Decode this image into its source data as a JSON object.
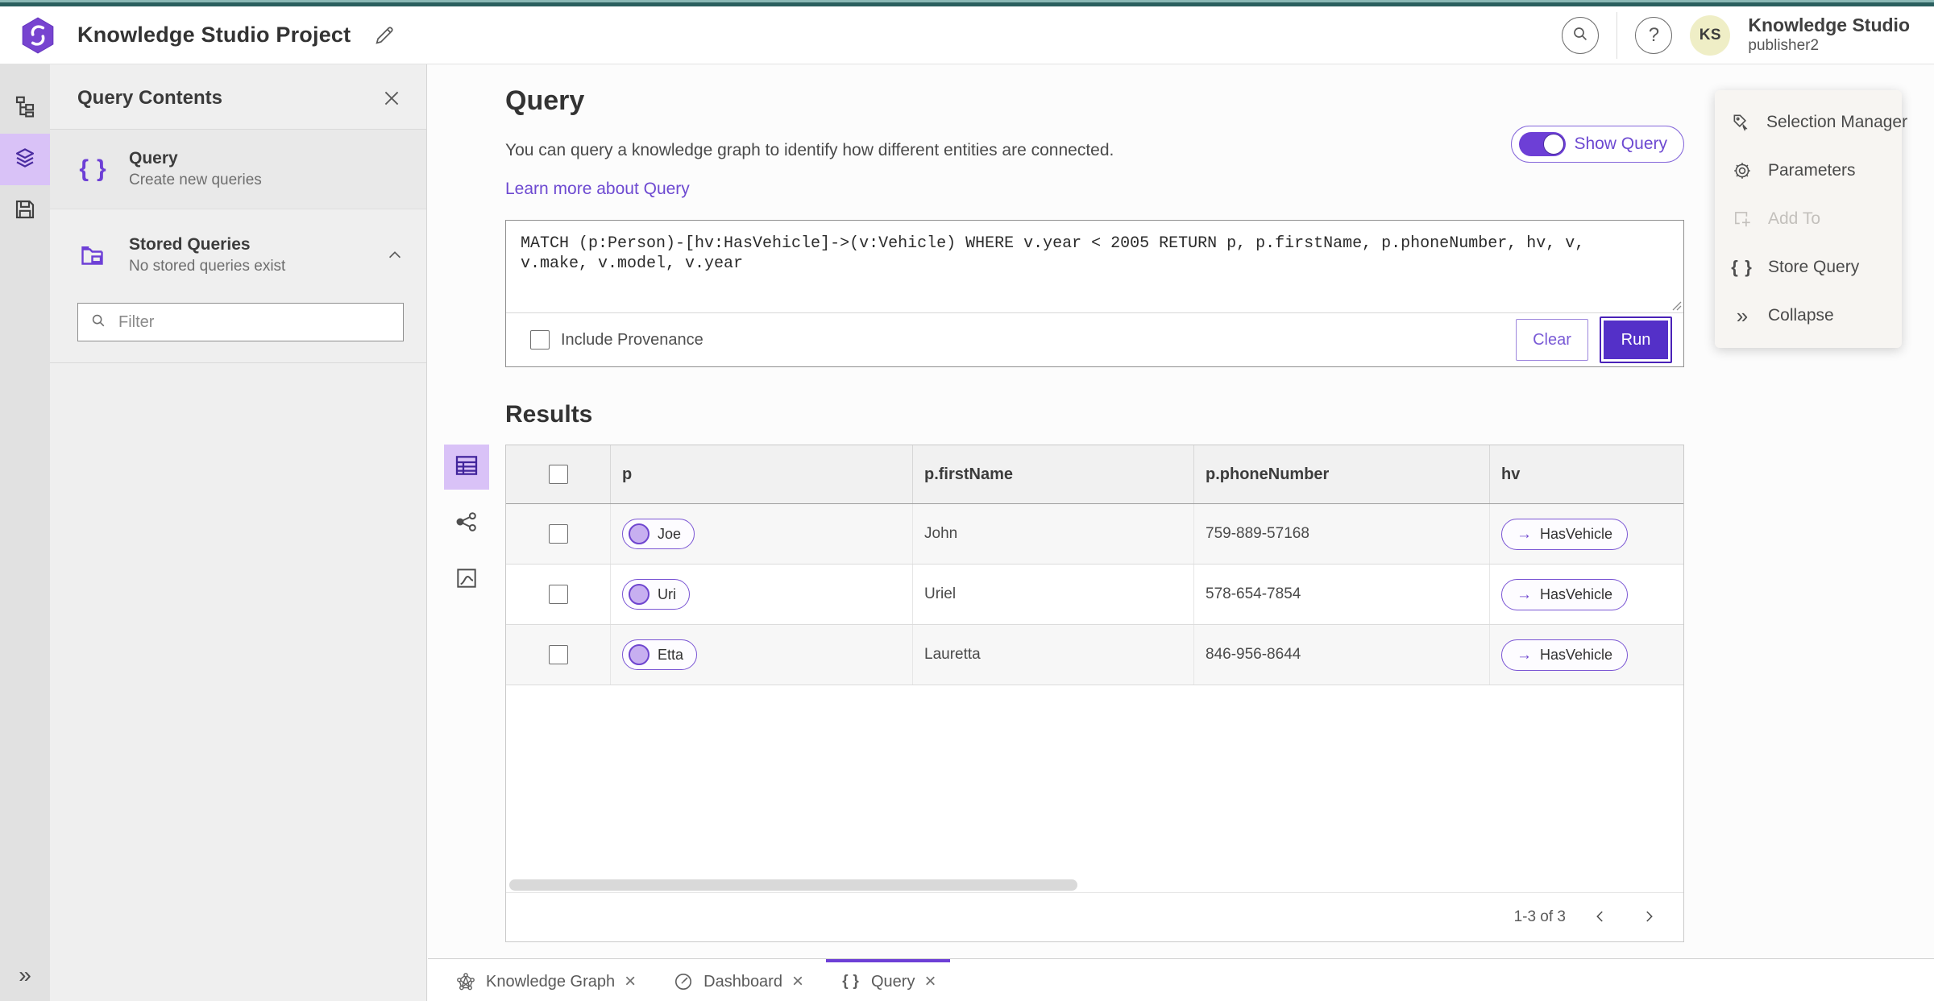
{
  "colors": {
    "accent": "#6d3fd6",
    "accent_dark": "#5430c8",
    "accent_light": "#d9c2f7",
    "link": "#6d49d1",
    "topbar_teal": "#2a5f5e",
    "avatar_bg": "#efeec6"
  },
  "header": {
    "app_title": "Knowledge Studio Project",
    "product_name": "Knowledge Studio",
    "user_role": "publisher2",
    "avatar_initials": "KS"
  },
  "sidebar": {
    "panel_title": "Query Contents",
    "query_item": {
      "label": "Query",
      "description": "Create new queries"
    },
    "stored_item": {
      "label": "Stored Queries",
      "description": "No stored queries exist"
    },
    "filter_placeholder": "Filter"
  },
  "query": {
    "title": "Query",
    "description": "You can query a knowledge graph to identify how different entities are connected.",
    "learn_more_label": "Learn more about Query",
    "show_query_label": "Show Query",
    "query_text": "MATCH (p:Person)-[hv:HasVehicle]->(v:Vehicle) WHERE v.year < 2005 RETURN p, p.firstName, p.phoneNumber, hv, v, v.make, v.model, v.year",
    "include_provenance_label": "Include Provenance",
    "clear_label": "Clear",
    "run_label": "Run"
  },
  "tools": {
    "items": [
      {
        "label": "Selection Manager"
      },
      {
        "label": "Parameters"
      },
      {
        "label": "Add To"
      },
      {
        "label": "Store Query"
      },
      {
        "label": "Collapse"
      }
    ]
  },
  "results": {
    "title": "Results",
    "columns": {
      "c1": "p",
      "c2": "p.firstName",
      "c3": "p.phoneNumber",
      "c4": "hv"
    },
    "rows": [
      {
        "p": "Joe",
        "firstName": "John",
        "phoneNumber": "759-889-57168",
        "hv": "HasVehicle"
      },
      {
        "p": "Uri",
        "firstName": "Uriel",
        "phoneNumber": "578-654-7854",
        "hv": "HasVehicle"
      },
      {
        "p": "Etta",
        "firstName": "Lauretta",
        "phoneNumber": "846-956-8644",
        "hv": "HasVehicle"
      }
    ],
    "edge_arrow": "→",
    "pagination": "1-3 of 3"
  },
  "tabs": {
    "t1": "Knowledge Graph",
    "t2": "Dashboard",
    "t3": "Query"
  }
}
